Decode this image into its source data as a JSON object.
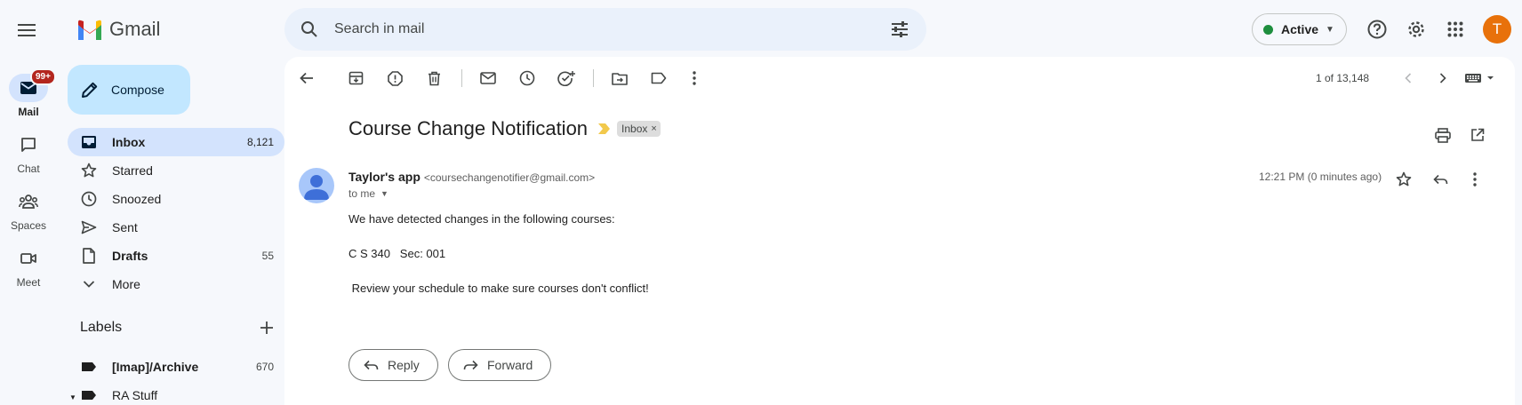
{
  "app": {
    "name": "Gmail"
  },
  "search": {
    "placeholder": "Search in mail"
  },
  "header": {
    "status_label": "Active",
    "status_color": "#1e8e3e",
    "avatar_initial": "T",
    "avatar_color": "#e8710a",
    "icons": [
      "help-icon",
      "settings-icon",
      "apps-icon"
    ]
  },
  "rail": {
    "mail_label": "Mail",
    "mail_badge": "99+",
    "chat_label": "Chat",
    "spaces_label": "Spaces",
    "meet_label": "Meet"
  },
  "sidebar": {
    "compose_label": "Compose",
    "items": [
      {
        "label": "Inbox",
        "count": "8,121",
        "icon": "inbox-icon"
      },
      {
        "label": "Starred",
        "count": "",
        "icon": "star-icon"
      },
      {
        "label": "Snoozed",
        "count": "",
        "icon": "clock-icon"
      },
      {
        "label": "Sent",
        "count": "",
        "icon": "send-icon"
      },
      {
        "label": "Drafts",
        "count": "55",
        "icon": "draft-icon"
      },
      {
        "label": "More",
        "count": "",
        "icon": "chevron-down-icon"
      }
    ],
    "labels_title": "Labels",
    "labels": [
      {
        "label": "[Imap]/Archive",
        "count": "670"
      },
      {
        "label": "RA Stuff",
        "count": ""
      }
    ]
  },
  "toolbar": {
    "pager_text": "1 of 13,148"
  },
  "message": {
    "subject": "Course Change Notification",
    "label_chip": "Inbox",
    "chip_close": "×",
    "sender_name": "Taylor's app",
    "sender_email": "<coursechangenotifier@gmail.com>",
    "to_text": "to me",
    "timestamp": "12:21 PM (0 minutes ago)",
    "body": [
      "We have detected changes in the following courses:",
      "C S 340   Sec: 001",
      " Review your schedule to make sure courses don't conflict!"
    ]
  },
  "actions": {
    "reply_label": "Reply",
    "forward_label": "Forward"
  }
}
